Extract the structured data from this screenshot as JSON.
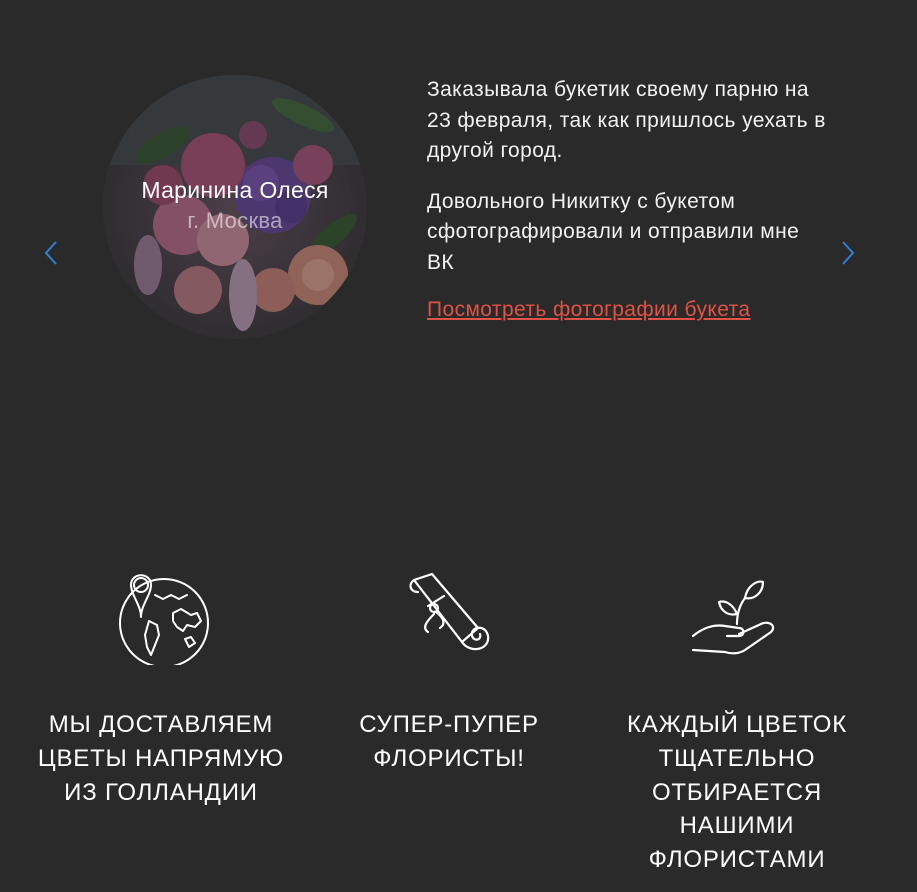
{
  "review": {
    "name": "Маринина Олеся",
    "city": "г. Москва",
    "paragraph_1": "Заказывала букетик своему парню на 23 февраля, так как пришлось уехать в другой город.",
    "paragraph_2": "Довольного Никитку с букетом сфотографировали и отправили мне ВК",
    "link_label": "Посмотреть фотографии букета"
  },
  "slider": {
    "prev_icon": "chevron-left-icon",
    "next_icon": "chevron-right-icon",
    "arrow_color": "#2f7fd6"
  },
  "features": [
    {
      "icon": "globe-location-icon",
      "title": "Мы доставляем\nцветы напрямую\nиз Голландии"
    },
    {
      "icon": "scroll-diploma-icon",
      "title": "Супер-пупер\nфлористы!"
    },
    {
      "icon": "hand-sprout-icon",
      "title": "Каждый цветок\nтщательно\nотбирается\nнашими\nфлористами"
    }
  ],
  "colors": {
    "background": "#2b2a2b",
    "link": "#e05243",
    "text": "#f2f2f2"
  }
}
